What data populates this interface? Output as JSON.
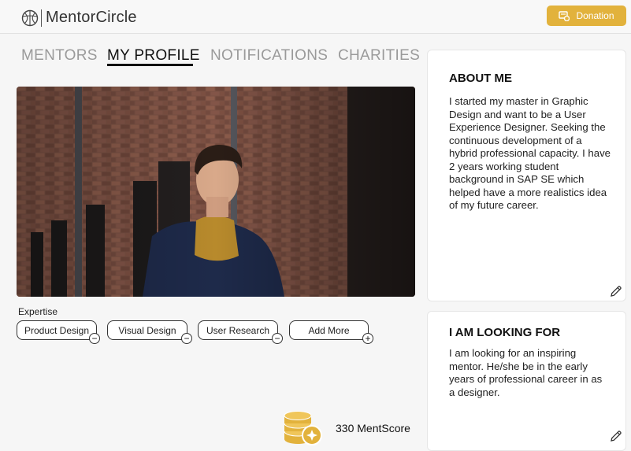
{
  "app": {
    "name": "MentorCircle",
    "donate_label": "Donation",
    "accent_color": "#e2b23c"
  },
  "tabs": [
    {
      "label": "MENTORS",
      "active": false
    },
    {
      "label": "MY PROFILE",
      "active": true
    },
    {
      "label": "NOTIFICATIONS",
      "active": false
    },
    {
      "label": "CHARITIES",
      "active": false
    }
  ],
  "profile": {
    "expertise_label": "Expertise",
    "expertise": [
      {
        "label": "Product Design",
        "action": "remove"
      },
      {
        "label": "Visual Design",
        "action": "remove"
      },
      {
        "label": "User Research",
        "action": "remove"
      },
      {
        "label": "Add More",
        "action": "add"
      }
    ],
    "score_text": "330 MentScore"
  },
  "about": {
    "title": "ABOUT ME",
    "body": "I started my master in Graphic Design and want to be a User Experience Designer. Seeking the continuous development of a hybrid professional capacity. I have 2 years working student background in SAP SE which helped have a more realistics idea of my future career."
  },
  "looking_for": {
    "title": "I AM LOOKING FOR",
    "body": "I am looking for an inspiring mentor. He/she be in the early years of professional career in as a designer."
  }
}
